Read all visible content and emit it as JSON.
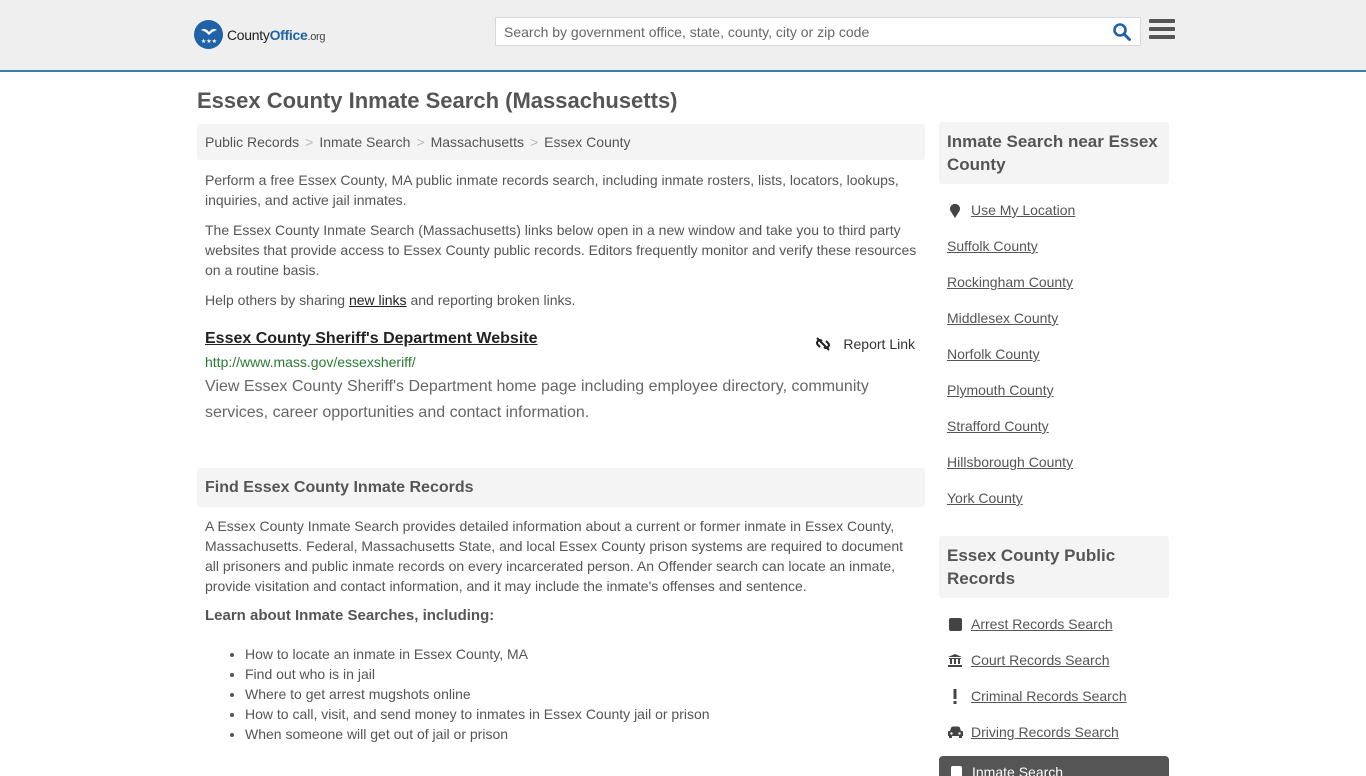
{
  "header": {
    "logo": {
      "brand_prefix": "County",
      "brand_bold": "Office",
      "brand_suffix": ".org"
    },
    "search": {
      "placeholder": "Search by government office, state, county, city or zip code",
      "value": ""
    },
    "accent_color": "#1f62a8",
    "border_color": "#3a7eab"
  },
  "page": {
    "title": "Essex County Inmate Search (Massachusetts)"
  },
  "breadcrumb": [
    "Public Records",
    "Inmate Search",
    "Massachusetts",
    "Essex County"
  ],
  "intro": {
    "p1": "Perform a free Essex County, MA public inmate records search, including inmate rosters, lists, locators, lookups, inquiries, and active jail inmates.",
    "p2": "The Essex County Inmate Search (Massachusetts) links below open in a new window and take you to third party websites that provide access to Essex County public records. Editors frequently monitor and verify these resources on a routine basis.",
    "p3_prefix": "Help others by sharing ",
    "p3_link": "new links",
    "p3_suffix": " and reporting broken links."
  },
  "listing": {
    "title": "Essex County Sheriff's Department Website",
    "report_label": "Report Link",
    "url": "http://www.mass.gov/essexsheriff/",
    "description": "View Essex County Sheriff's Department home page including employee directory, community services, career opportunities and contact information."
  },
  "find_section": {
    "heading": "Find Essex County Inmate Records",
    "body": "A Essex County Inmate Search provides detailed information about a current or former inmate in Essex County, Massachusetts. Federal, Massachusetts State, and local Essex County prison systems are required to document all prisoners and public inmate records on every incarcerated person. An Offender search can locate an inmate, provide visitation and contact information, and it may include the inmate's offenses and sentence.",
    "subheading": "Learn about Inmate Searches, including:",
    "items": [
      "How to locate an inmate in Essex County, MA",
      "Find out who is in jail",
      "Where to get arrest mugshots online",
      "How to call, visit, and send money to inmates in Essex County jail or prison",
      "When someone will get out of jail or prison"
    ]
  },
  "sidebar": {
    "nearby_heading": "Inmate Search near Essex County",
    "use_location": "Use My Location",
    "nearby": [
      "Suffolk County",
      "Rockingham County",
      "Middlesex County",
      "Norfolk County",
      "Plymouth County",
      "Strafford County",
      "Hillsborough County",
      "York County"
    ],
    "records_heading": "Essex County Public Records",
    "records": [
      {
        "label": "Arrest Records Search",
        "icon": "square-icon"
      },
      {
        "label": "Court Records Search",
        "icon": "courthouse-icon"
      },
      {
        "label": "Criminal Records Search",
        "icon": "exclamation-icon"
      },
      {
        "label": "Driving Records Search",
        "icon": "car-icon"
      }
    ],
    "active_record": "Inmate Search"
  }
}
